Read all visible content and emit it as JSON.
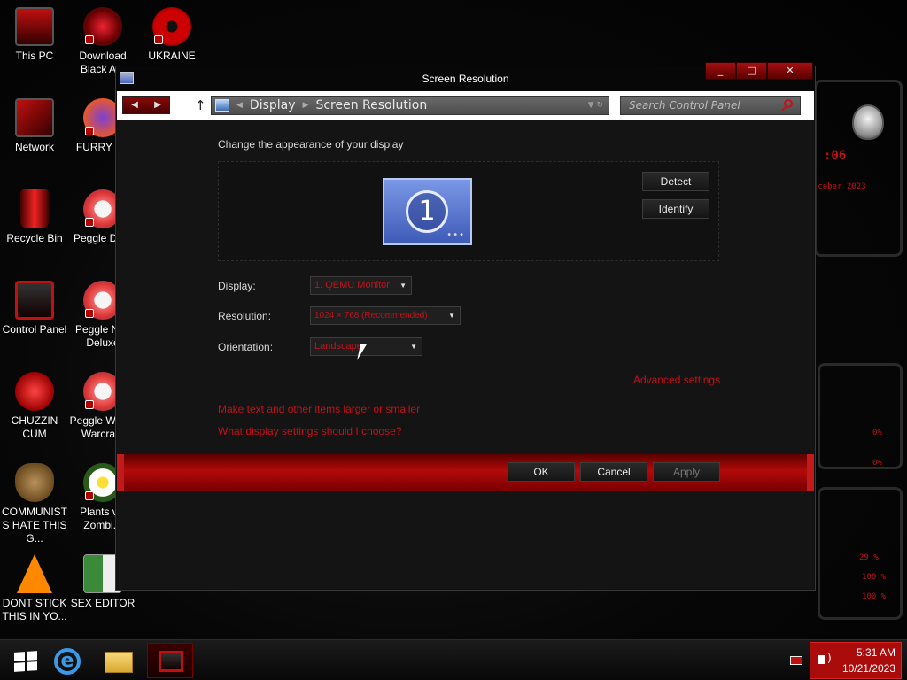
{
  "desktop": {
    "icons": [
      {
        "label": "This PC"
      },
      {
        "label": "Download Black A..."
      },
      {
        "label": "UKRAINE"
      },
      {
        "label": "Network"
      },
      {
        "label": "FURRY F..."
      },
      {
        "label": "Recycle Bin"
      },
      {
        "label": "Peggle De..."
      },
      {
        "label": "Control Panel"
      },
      {
        "label": "Peggle Ni... Deluxe"
      },
      {
        "label": "CHUZZIN CUM"
      },
      {
        "label": "Peggle W... of Warcra..."
      },
      {
        "label": "COMMUNISTS HATE THIS G..."
      },
      {
        "label": "Plants v... Zombi..."
      },
      {
        "label": "DONT STICK THIS IN YO..."
      },
      {
        "label": "SEX EDITOR"
      }
    ]
  },
  "window": {
    "title": "Screen Resolution",
    "controls": {
      "minimize": "_",
      "maximize": "□",
      "close": "✕"
    }
  },
  "nav": {
    "back": "◀",
    "forward": "▶",
    "up": "↑",
    "breadcrumb": [
      "Display",
      "Screen Resolution"
    ],
    "search_placeholder": "Search Control Panel"
  },
  "main": {
    "heading": "Change the appearance of your display",
    "monitor_number": "1",
    "detect_label": "Detect",
    "identify_label": "Identify",
    "display_label": "Display:",
    "display_value": "1. QEMU Monitor",
    "resolution_label": "Resolution:",
    "resolution_value": "1024 × 768 (Recommended)",
    "orientation_label": "Orientation:",
    "orientation_value": "Landscape",
    "advanced_link": "Advanced settings",
    "link_text_size": "Make text and other items larger or smaller",
    "link_help": "What display settings should I choose?"
  },
  "footer": {
    "ok": "OK",
    "cancel": "Cancel",
    "apply": "Apply"
  },
  "taskbar": {
    "time": "5:31 AM",
    "date": "10/21/2023"
  },
  "colors": {
    "accent": "#c2111a",
    "footer_red": "#b30a0a",
    "tray_red": "#aa0c0c"
  }
}
